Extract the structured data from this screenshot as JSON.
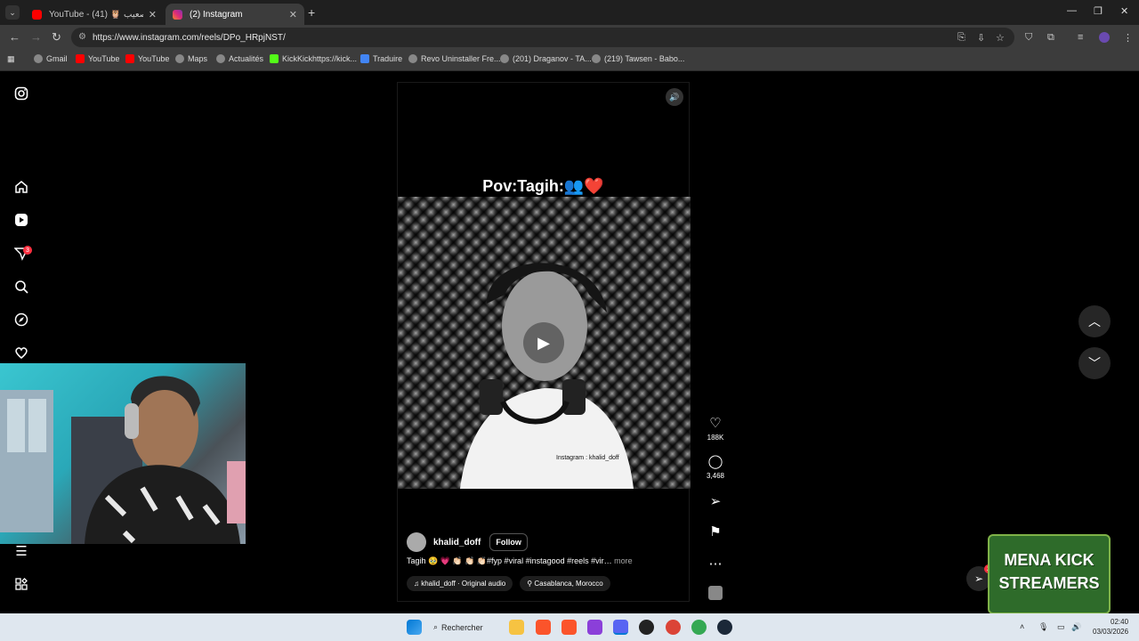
{
  "browser": {
    "tabs": [
      {
        "title": "YouTube - تحدي صعيب 🦉 (41)",
        "active": false
      },
      {
        "title": "(2) Instagram",
        "active": true
      }
    ],
    "url": "https://www.instagram.com/reels/DPo_HRpjNST/",
    "bookmarks": [
      "Gmail",
      "YouTube",
      "YouTube",
      "Maps",
      "Actualités",
      "KickKickhttps://kick...",
      "Traduire",
      "Revo Uninstaller Fre...",
      "(201) Draganov - TA...",
      "(219) Tawsen - Babo..."
    ]
  },
  "sidebar": {
    "notification_count": "3"
  },
  "reel": {
    "overlay_caption": "Pov:Tagih:👥❤️",
    "username": "khalid_doff",
    "follow_label": "Follow",
    "description": "Tagih 🥹 💗 👏🏻 👏🏻 👏🏻#fyp #viral #instagood #reels #vir…",
    "more_label": "more",
    "audio": "khalid_doff · Original audio",
    "location": "Casablanca, Morocco",
    "likes": "188K",
    "comments": "3,468",
    "video_watermark": "Instagram : khalid_doff"
  },
  "messages_badge": "2",
  "overlay_logo": "MENA KICK STREAMERS",
  "taskbar": {
    "search_label": "Rechercher",
    "time": "02:40",
    "date": "03/03/2026"
  },
  "colors": {
    "instagram_badge": "#ff3040",
    "logo_green": "#2e6b2a",
    "taskbar": "#dfe7ef"
  }
}
